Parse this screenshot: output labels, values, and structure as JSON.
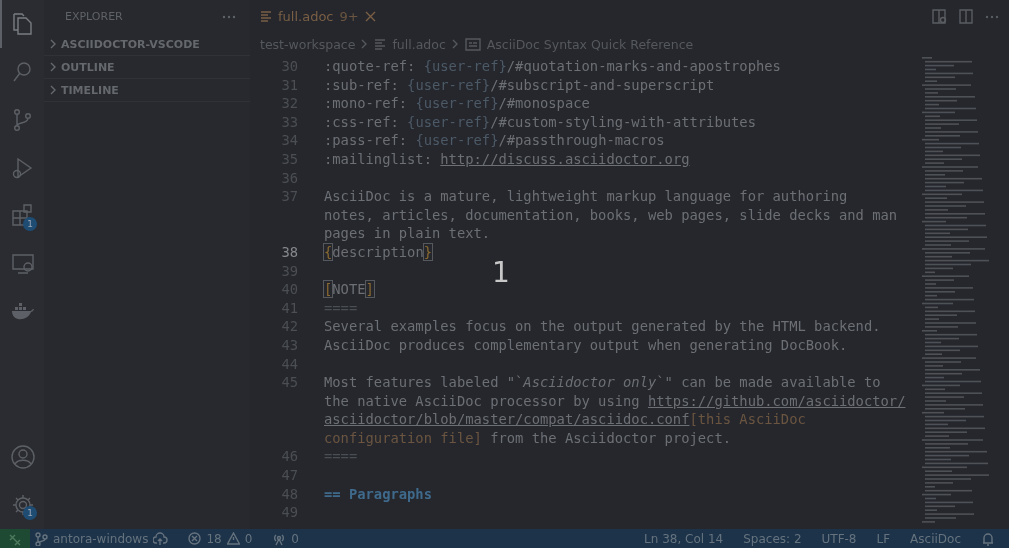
{
  "activity_bar": {
    "items": [
      {
        "kind": "files",
        "selected": true
      },
      {
        "kind": "search",
        "selected": false
      },
      {
        "kind": "source-control",
        "selected": false
      },
      {
        "kind": "run",
        "selected": false
      },
      {
        "kind": "extensions",
        "selected": false,
        "badge": "1"
      },
      {
        "kind": "remote",
        "selected": false
      },
      {
        "kind": "docker",
        "selected": false
      }
    ],
    "bottom": [
      {
        "kind": "account"
      },
      {
        "kind": "settings",
        "badge": "1"
      }
    ]
  },
  "sidebar": {
    "title": "EXPLORER",
    "sections": [
      {
        "label": "ASCIIDOCTOR-VSCODE",
        "expanded": false
      },
      {
        "label": "OUTLINE",
        "expanded": false
      },
      {
        "label": "TIMELINE",
        "expanded": false
      }
    ]
  },
  "tabs": [
    {
      "label": "full.adoc",
      "badge": "9+",
      "selected": true
    }
  ],
  "breadcrumbs": [
    "test-workspace",
    "full.adoc",
    "AsciiDoc Syntax Quick Reference"
  ],
  "editor": {
    "rows": [
      {
        "number": "30",
        "current": false,
        "segments": [
          {
            "kind": "plain",
            "text": ":quote-ref: "
          },
          {
            "kind": "attr",
            "text": "{user-ref}"
          },
          {
            "kind": "plain",
            "text": "/#quotation-marks-and-apostrophes"
          }
        ]
      },
      {
        "number": "31",
        "current": false,
        "segments": [
          {
            "kind": "plain",
            "text": ":sub-ref: "
          },
          {
            "kind": "attr",
            "text": "{user-ref}"
          },
          {
            "kind": "plain",
            "text": "/#subscript-and-superscript"
          }
        ]
      },
      {
        "number": "32",
        "current": false,
        "segments": [
          {
            "kind": "plain",
            "text": ":mono-ref: "
          },
          {
            "kind": "attr",
            "text": "{user-ref}"
          },
          {
            "kind": "plain",
            "text": "/#monospace"
          }
        ]
      },
      {
        "number": "33",
        "current": false,
        "segments": [
          {
            "kind": "plain",
            "text": ":css-ref: "
          },
          {
            "kind": "attr",
            "text": "{user-ref}"
          },
          {
            "kind": "plain",
            "text": "/#custom-styling-with-attributes"
          }
        ]
      },
      {
        "number": "34",
        "current": false,
        "segments": [
          {
            "kind": "plain",
            "text": ":pass-ref: "
          },
          {
            "kind": "attr",
            "text": "{user-ref}"
          },
          {
            "kind": "plain",
            "text": "/#passthrough-macros"
          }
        ]
      },
      {
        "number": "35",
        "current": false,
        "segments": [
          {
            "kind": "plain",
            "text": ":mailinglist: "
          },
          {
            "kind": "link",
            "text": "http://discuss.asciidoctor.org"
          }
        ]
      },
      {
        "number": "36",
        "current": false,
        "segments": []
      },
      {
        "number": "37",
        "current": false,
        "segments": [
          {
            "kind": "plain",
            "text": "AsciiDoc is a mature, lightweight markup language for authoring"
          }
        ]
      },
      {
        "segments": [
          {
            "kind": "plain",
            "text": "notes, articles, documentation, books, web pages, slide decks and man"
          }
        ]
      },
      {
        "segments": [
          {
            "kind": "plain",
            "text": "pages in plain text."
          }
        ]
      },
      {
        "number": "38",
        "current": true,
        "segments": [
          {
            "kind": "bracket",
            "text": "{"
          },
          {
            "kind": "plain",
            "text": "description"
          },
          {
            "kind": "bracket",
            "text": "}"
          }
        ]
      },
      {
        "number": "39",
        "current": false,
        "segments": []
      },
      {
        "number": "40",
        "current": false,
        "segments": [
          {
            "kind": "bracket",
            "text": "["
          },
          {
            "kind": "plain",
            "text": "NOTE"
          },
          {
            "kind": "bracket",
            "text": "]"
          }
        ]
      },
      {
        "number": "41",
        "current": false,
        "segments": [
          {
            "kind": "dim",
            "text": "===="
          }
        ]
      },
      {
        "number": "42",
        "current": false,
        "segments": [
          {
            "kind": "plain",
            "text": "Several examples focus on the output generated by the HTML backend."
          }
        ]
      },
      {
        "number": "43",
        "current": false,
        "segments": [
          {
            "kind": "plain",
            "text": "AsciiDoc produces complementary output when generating DocBook."
          }
        ]
      },
      {
        "number": "44",
        "current": false,
        "segments": []
      },
      {
        "number": "45",
        "current": false,
        "segments": [
          {
            "kind": "plain",
            "text": "Most features labeled \"`"
          },
          {
            "kind": "italic",
            "text": "Asciidoctor only"
          },
          {
            "kind": "plain",
            "text": "`\" can be made available to"
          }
        ]
      },
      {
        "segments": [
          {
            "kind": "plain",
            "text": "the native AsciiDoc processor by using "
          },
          {
            "kind": "link",
            "text": "https://github.com/asciidoctor/"
          }
        ]
      },
      {
        "segments": [
          {
            "kind": "link",
            "text": "asciidoctor/blob/master/compat/asciidoc.conf"
          },
          {
            "kind": "macro",
            "text": "[this AsciiDoc"
          }
        ]
      },
      {
        "segments": [
          {
            "kind": "macro",
            "text": "configuration file]"
          },
          {
            "kind": "plain",
            "text": " from the Asciidoctor project."
          }
        ]
      },
      {
        "number": "46",
        "current": false,
        "segments": [
          {
            "kind": "dim",
            "text": "===="
          }
        ]
      },
      {
        "number": "47",
        "current": false,
        "segments": []
      },
      {
        "number": "48",
        "current": false,
        "segments": [
          {
            "kind": "heading",
            "text": "== Paragraphs"
          }
        ]
      },
      {
        "number": "49",
        "current": false,
        "segments": []
      }
    ]
  },
  "overlay": {
    "text": "1"
  },
  "status_bar": {
    "branch": "antora-windows",
    "errors": "18",
    "warnings": "0",
    "ports": "0",
    "right": [
      "Ln 38, Col 14",
      "Spaces: 2",
      "UTF-8",
      "LF",
      "AsciiDoc"
    ]
  }
}
